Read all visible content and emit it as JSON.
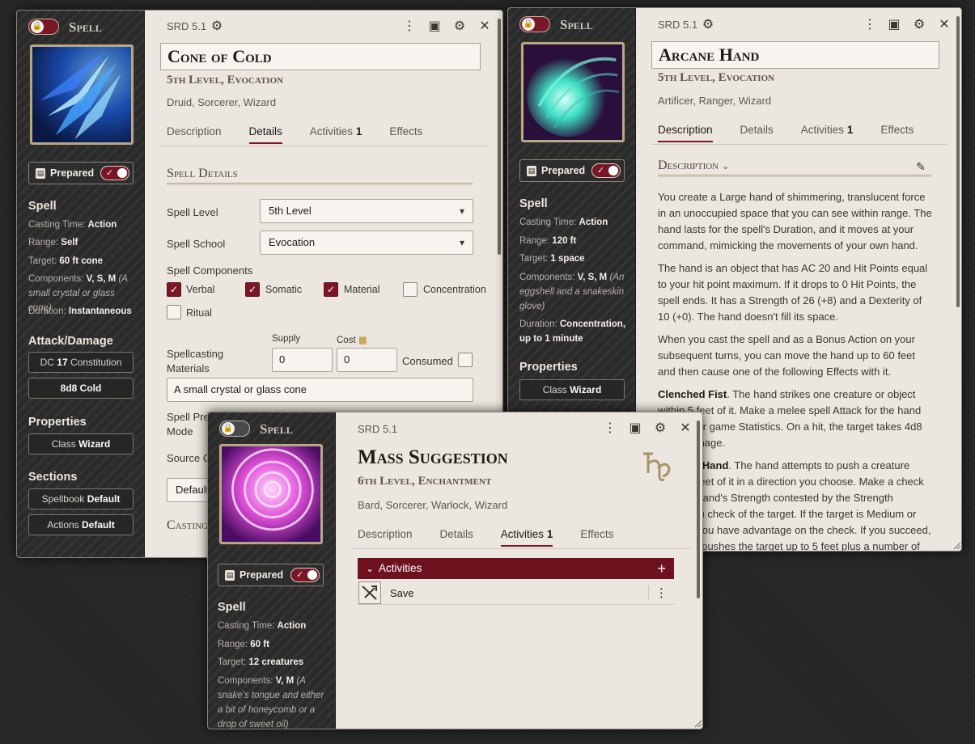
{
  "colors": {
    "accent": "#7a1726",
    "parchment": "#ebe6df",
    "sidebar": "#2f2f2f"
  },
  "win1": {
    "doc_type": "Spell",
    "source": "SRD 5.1",
    "title": "Cone of Cold",
    "subtitle": "5th Level, Evocation",
    "classes": "Druid, Sorcerer, Wizard",
    "tabs": [
      {
        "label": "Description"
      },
      {
        "label": "Details"
      },
      {
        "label": "Activities",
        "count": "1"
      },
      {
        "label": "Effects"
      }
    ],
    "prepared_label": "Prepared",
    "sidebar": {
      "spell_heading": "Spell",
      "casting_time_label": "Casting Time:",
      "casting_time": "Action",
      "range_label": "Range:",
      "range": "Self",
      "target_label": "Target:",
      "target": "60 ft cone",
      "components_label": "Components:",
      "components": "V, S, M",
      "components_note": "(A small crystal or glass cone)",
      "duration_label": "Duration:",
      "duration": "Instantaneous",
      "attack_heading": "Attack/Damage",
      "dc_prefix": "DC",
      "dc_value": "17",
      "dc_ability": "Constitution",
      "damage_formula": "8d8",
      "damage_type": "Cold",
      "properties_heading": "Properties",
      "class_label": "Class",
      "class_value": "Wizard",
      "sections_heading": "Sections",
      "spellbook_label": "Spellbook",
      "spellbook_value": "Default",
      "actions_label": "Actions",
      "actions_value": "Default"
    },
    "details": {
      "section_title": "Spell Details",
      "level_label": "Spell Level",
      "level_value": "5th Level",
      "school_label": "Spell School",
      "school_value": "Evocation",
      "components_label": "Spell Components",
      "checkboxes": [
        {
          "label": "Verbal",
          "checked": true
        },
        {
          "label": "Somatic",
          "checked": true
        },
        {
          "label": "Material",
          "checked": true
        },
        {
          "label": "Concentration",
          "checked": false
        },
        {
          "label": "Ritual",
          "checked": false
        }
      ],
      "materials_label_1": "Spellcasting",
      "materials_label_2": "Materials",
      "supply_label": "Supply",
      "supply_value": "0",
      "cost_label": "Cost",
      "cost_value": "0",
      "consumed_label": "Consumed",
      "materials_text": "A small crystal or glass cone",
      "prep_label_1": "Spell Pre",
      "prep_label_2": "Mode",
      "source_label": "Source C",
      "source_value": "Default",
      "casting_label": "Casting"
    }
  },
  "win2": {
    "doc_type": "Spell",
    "source": "SRD 5.1",
    "title": "Arcane Hand",
    "subtitle": "5th Level, Evocation",
    "classes": "Artificer, Ranger, Wizard",
    "tabs": [
      {
        "label": "Description"
      },
      {
        "label": "Details"
      },
      {
        "label": "Activities",
        "count": "1"
      },
      {
        "label": "Effects"
      }
    ],
    "prepared_label": "Prepared",
    "sidebar": {
      "spell_heading": "Spell",
      "casting_time_label": "Casting Time:",
      "casting_time": "Action",
      "range_label": "Range:",
      "range": "120 ft",
      "target_label": "Target:",
      "target": "1 space",
      "components_label": "Components:",
      "components": "V, S, M",
      "components_note": "(An eggshell and a snakeskin glove)",
      "duration_label": "Duration:",
      "duration": "Concentration, up to 1 minute",
      "properties_heading": "Properties",
      "class_label": "Class",
      "class_value": "Wizard"
    },
    "description": {
      "heading": "Description",
      "p1": "You create a Large hand of shimmering, translucent force in an unoccupied space that you can see within range. The hand lasts for the spell's Duration, and it moves at your command, mimicking the movements of your own hand.",
      "p2": "The hand is an object that has AC 20 and Hit Points equal to your hit point maximum. If it drops to 0 Hit Points, the spell ends. It has a Strength of 26 (+8) and a Dexterity of 10 (+0). The hand doesn't fill its space.",
      "p3": "When you cast the spell and as a Bonus Action on your subsequent turns, you can move the hand up to 60 feet and then cause one of the following Effects with it.",
      "p4_bold": "Clenched Fist",
      "p4": ". The hand strikes one creature or object within 5 feet of it. Make a melee spell Attack for the hand using your game Statistics. On a hit, the target takes 4d8 force damage.",
      "p5_bold": "Forceful Hand",
      "p5": ". The hand attempts to push a creature within 5 feet of it in a direction you choose. Make a check with the hand's Strength contested by the Strength (Athletics) check of the target. If the target is Medium or smaller, you have advantage on the check. If you succeed, the hand pushes the target up to 5 feet plus a number of feet equal to five"
    }
  },
  "win3": {
    "doc_type": "Spell",
    "source": "SRD 5.1",
    "title": "Mass Suggestion",
    "subtitle": "6th Level, Enchantment",
    "classes": "Bard, Sorcerer, Warlock, Wizard",
    "tabs": [
      {
        "label": "Description"
      },
      {
        "label": "Details"
      },
      {
        "label": "Activities",
        "count": "1"
      },
      {
        "label": "Effects"
      }
    ],
    "prepared_label": "Prepared",
    "school_icon": "enchantment-school-icon",
    "sidebar": {
      "spell_heading": "Spell",
      "casting_time_label": "Casting Time:",
      "casting_time": "Action",
      "range_label": "Range:",
      "range": "60 ft",
      "target_label": "Target:",
      "target": "12 creatures",
      "components_label": "Components:",
      "components": "V, M",
      "components_note": "(A snake's tongue and either a bit of honeycomb or a drop of sweet oil)"
    },
    "activities": {
      "header": "Activities",
      "items": [
        {
          "name": "Save"
        }
      ]
    }
  }
}
